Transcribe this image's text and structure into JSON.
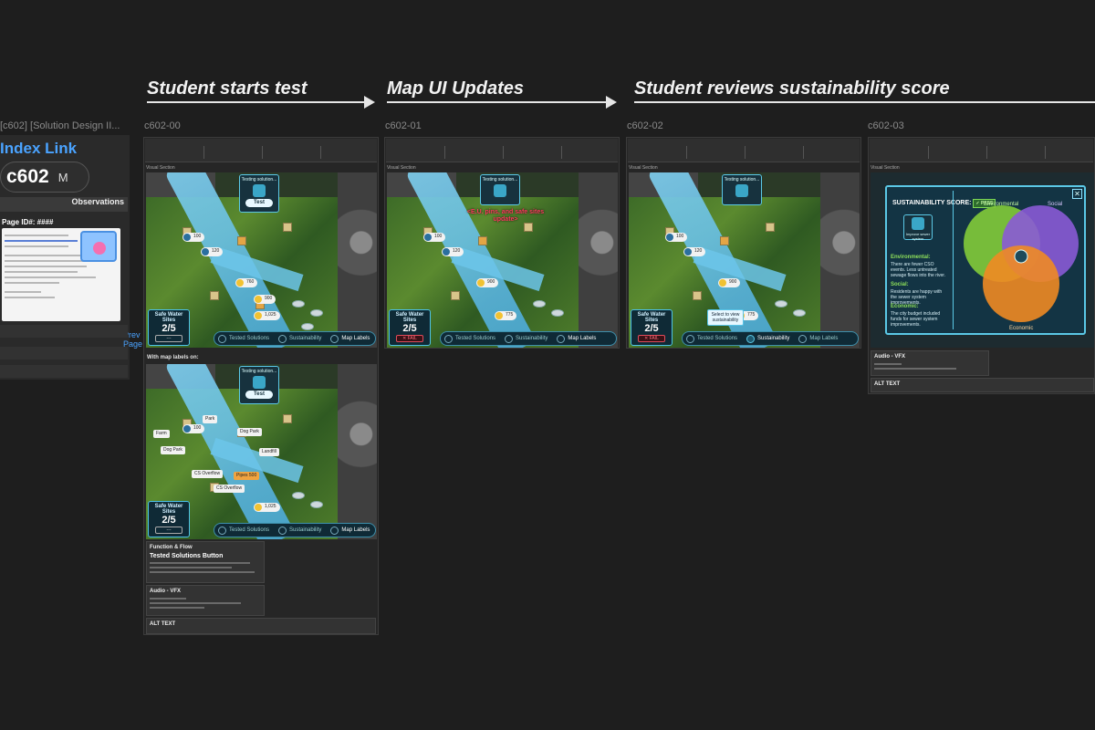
{
  "flow": {
    "steps": [
      {
        "label": "Student starts test"
      },
      {
        "label": "Map UI Updates"
      },
      {
        "label": "Student reviews sustainability score"
      }
    ]
  },
  "index": {
    "title": "[c602] [Solution Design II...",
    "link_label": "Index Link",
    "code": "c602",
    "code_suffix": "M",
    "observations": "Observations",
    "page_id": "Page ID#: ####",
    "prev_page": "Prev Page"
  },
  "frames": [
    {
      "id": "c602-00"
    },
    {
      "id": "c602-01"
    },
    {
      "id": "c602-02"
    },
    {
      "id": "c602-03"
    }
  ],
  "game": {
    "testing_title": "Testing solution...",
    "test_button": "Test",
    "improve_caption": "Improve sewer system",
    "safe_water_title": "Safe Water Sites",
    "safe_water_count": "2/5",
    "fail_badge": "✕ FAIL",
    "empty_badge": "---",
    "tab_tested": "Tested Solutions",
    "tab_sustainability": "Sustainability",
    "tab_map_labels": "Map Labels",
    "pill_values": [
      "100",
      "120",
      "760",
      "900",
      "775",
      "1,025"
    ],
    "callout": "<E.U. pins, and safe sites update>",
    "select_tip": "Select to view sustainability",
    "map_labels": [
      "Park",
      "Farm",
      "Dog Park",
      "Dog Park",
      "Landfill",
      "CS Overflow",
      "CS Overflow",
      "Pipes 500"
    ]
  },
  "sections": {
    "visual_section": "Visual Section",
    "with_labels": "With map labels on:",
    "function_title": "Function & Flow",
    "tested_solutions_heading": "Tested Solutions Button",
    "audio_title": "Audio - VFX",
    "alt_text": "ALT TEXT"
  },
  "sustainability": {
    "title": "SUSTAINABILITY SCORE:",
    "pass_badge": "✓ PASS",
    "close": "✕",
    "improve_caption": "Improve sewer system",
    "environmental_label": "Environmental:",
    "environmental_text": "There are fewer CSO events. Less untreated sewage flows into the river.",
    "social_label": "Social:",
    "social_text": "Residents are happy with the sewer system improvements.",
    "economic_label": "Economic:",
    "economic_text": "The city budget included funds for sewer system improvements.",
    "venn": {
      "environmental": "Environmental",
      "social": "Social",
      "economic": "Economic",
      "colors": {
        "environmental": "#7cc43a",
        "social": "#8a5ad6",
        "economic": "#f08a24",
        "overlap": "#9fe0f5"
      }
    }
  }
}
